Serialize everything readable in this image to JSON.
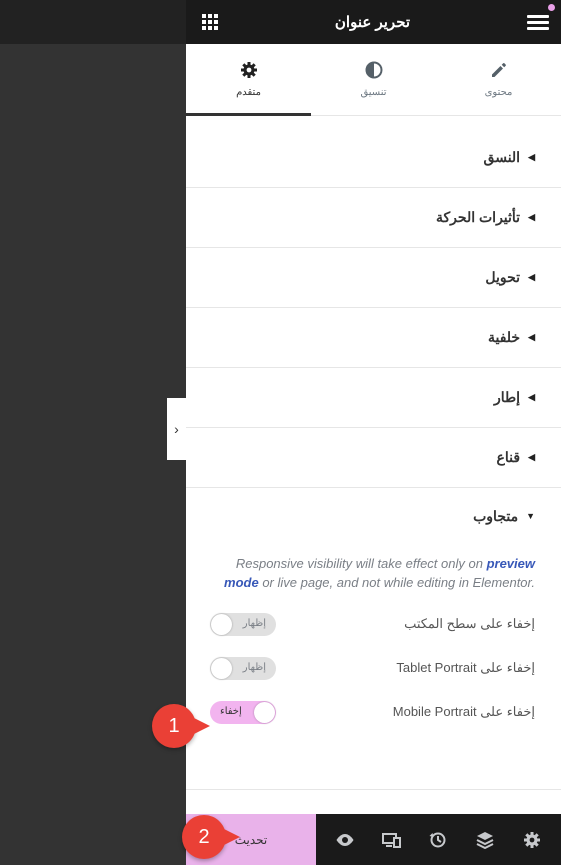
{
  "header": {
    "title": "تحرير عنوان"
  },
  "tabs": [
    {
      "label": "محتوى",
      "icon": "pencil-icon"
    },
    {
      "label": "تنسيق",
      "icon": "contrast-icon"
    },
    {
      "label": "متقدم",
      "icon": "gear-icon",
      "active": true
    }
  ],
  "sections": [
    {
      "label": "النسق"
    },
    {
      "label": "تأثيرات الحركة"
    },
    {
      "label": "تحويل"
    },
    {
      "label": "خلفية"
    },
    {
      "label": "إطار"
    },
    {
      "label": "قناع"
    }
  ],
  "responsive": {
    "label": "متجاوب",
    "note_prefix": "Responsive visibility will take effect only on ",
    "note_link": "preview mode",
    "note_suffix": " or live page, and not while editing in Elementor.",
    "rows": [
      {
        "label": "إخفاء على سطح المكتب",
        "toggle_label": "إظهار",
        "state": "off"
      },
      {
        "label": "إخفاء على Tablet Portrait",
        "toggle_label": "إظهار",
        "state": "off"
      },
      {
        "label": "إخفاء على Mobile Portrait",
        "toggle_label": "إخفاء",
        "state": "on"
      }
    ]
  },
  "footer": {
    "update_label": "تحديث"
  },
  "annotations": {
    "badge1": "1",
    "badge2": "2"
  },
  "colors": {
    "accent": "#e9b2ea",
    "badge": "#ea4036",
    "header_bg": "#1a1a1a"
  }
}
